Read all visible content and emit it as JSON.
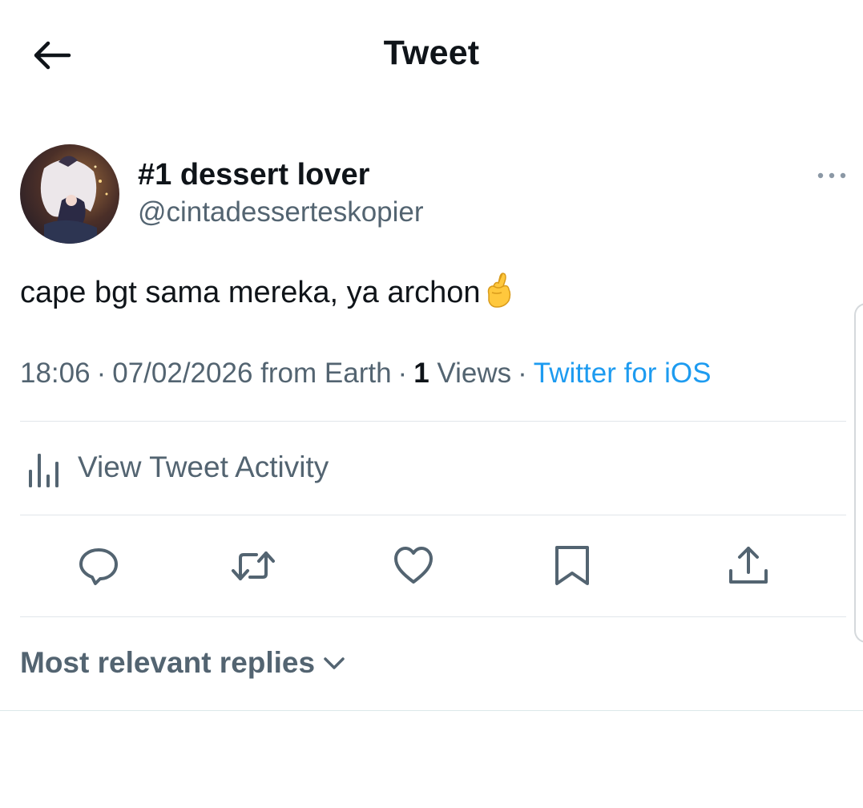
{
  "header": {
    "title": "Tweet"
  },
  "tweet": {
    "author_name": "#1 dessert lover",
    "author_handle": "@cintadesserteskopier",
    "text": "cape bgt sama mereka, ya archon",
    "emoji": "crossed-fingers",
    "time": "18:06",
    "date": "07/02/2026",
    "location": "from Earth",
    "views_count": "1",
    "views_label": "Views",
    "source": "Twitter for iOS",
    "separator": "·"
  },
  "activity": {
    "label": "View Tweet Activity",
    "icon": "bar-chart-icon"
  },
  "actions": [
    {
      "name": "reply",
      "icon": "reply-icon"
    },
    {
      "name": "retweet",
      "icon": "retweet-icon"
    },
    {
      "name": "like",
      "icon": "heart-icon"
    },
    {
      "name": "bookmark",
      "icon": "bookmark-icon"
    },
    {
      "name": "share",
      "icon": "share-icon"
    }
  ],
  "replies": {
    "sort_label": "Most relevant replies"
  },
  "colors": {
    "text": "#0f1419",
    "secondary": "#536471",
    "link": "#1d9bf0",
    "divider": "#e1e6ea"
  }
}
